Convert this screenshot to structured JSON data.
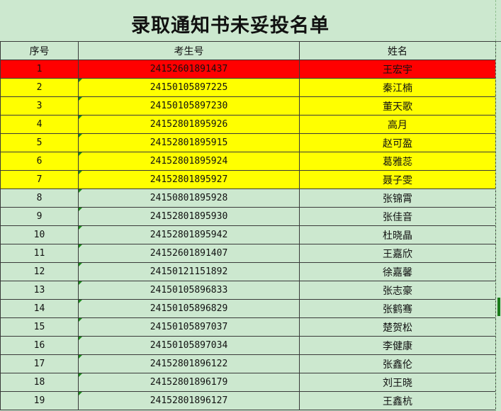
{
  "sheet": {
    "title": "录取通知书未妥投名单",
    "headers": [
      "序号",
      "考生号",
      "姓名"
    ],
    "colors": {
      "background": "#cce8cf",
      "highlight_red": "#ff0000",
      "highlight_yellow": "#ffff00"
    },
    "rows": [
      {
        "seq": "1",
        "id": "24152601891437",
        "name": "王宏宇",
        "fill": "#ff0000"
      },
      {
        "seq": "2",
        "id": "24150105897225",
        "name": "秦江楠",
        "fill": "#ffff00"
      },
      {
        "seq": "3",
        "id": "24150105897230",
        "name": "董天歌",
        "fill": "#ffff00"
      },
      {
        "seq": "4",
        "id": "24152801895926",
        "name": "高月",
        "fill": "#ffff00"
      },
      {
        "seq": "5",
        "id": "24152801895915",
        "name": "赵可盈",
        "fill": "#ffff00"
      },
      {
        "seq": "6",
        "id": "24152801895924",
        "name": "葛雅蕊",
        "fill": "#ffff00"
      },
      {
        "seq": "7",
        "id": "24152801895927",
        "name": "聂子雯",
        "fill": "#ffff00"
      },
      {
        "seq": "8",
        "id": "24150801895928",
        "name": "张锦霄",
        "fill": ""
      },
      {
        "seq": "9",
        "id": "24152801895930",
        "name": "张佳音",
        "fill": ""
      },
      {
        "seq": "10",
        "id": "24152801895942",
        "name": "杜晓晶",
        "fill": ""
      },
      {
        "seq": "11",
        "id": "24152601891407",
        "name": "王嘉欣",
        "fill": ""
      },
      {
        "seq": "12",
        "id": "24150121151892",
        "name": "徐嘉馨",
        "fill": ""
      },
      {
        "seq": "13",
        "id": "24150105896833",
        "name": "张志豪",
        "fill": ""
      },
      {
        "seq": "14",
        "id": "24150105896829",
        "name": "张鹤骞",
        "fill": ""
      },
      {
        "seq": "15",
        "id": "24150105897037",
        "name": "楚贺松",
        "fill": ""
      },
      {
        "seq": "16",
        "id": "24150105897034",
        "name": "李健康",
        "fill": ""
      },
      {
        "seq": "17",
        "id": "24152801896122",
        "name": "张鑫伦",
        "fill": ""
      },
      {
        "seq": "18",
        "id": "24152801896179",
        "name": "刘王晓",
        "fill": ""
      },
      {
        "seq": "19",
        "id": "24152801896127",
        "name": "王鑫杭",
        "fill": ""
      }
    ]
  }
}
